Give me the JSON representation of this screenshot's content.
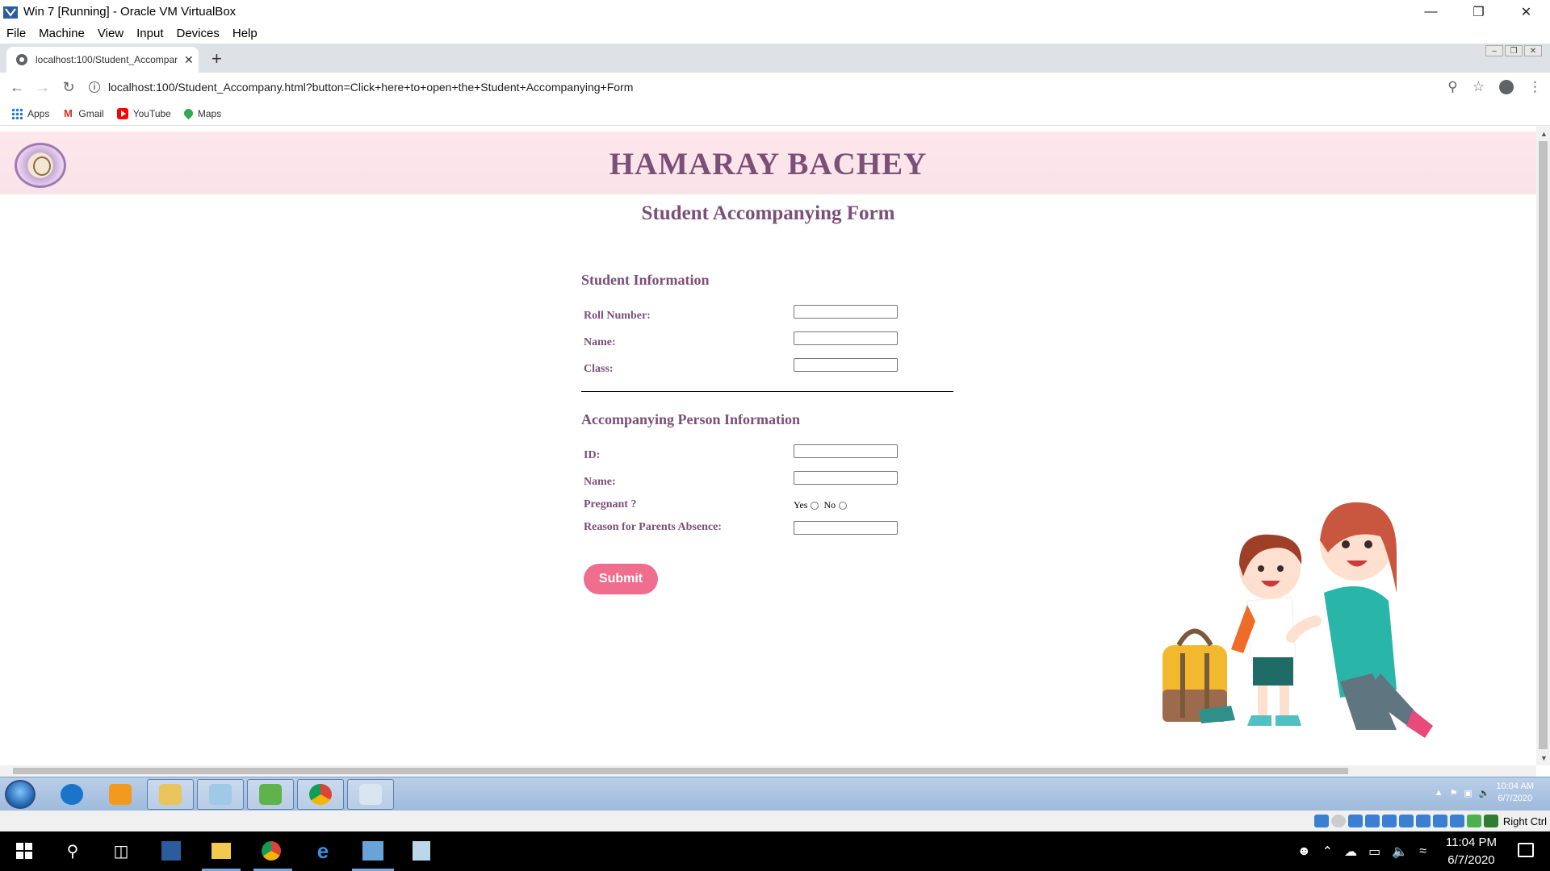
{
  "vbox": {
    "window_title": "Win 7 [Running] - Oracle VM VirtualBox",
    "menu": [
      "File",
      "Machine",
      "View",
      "Input",
      "Devices",
      "Help"
    ],
    "host_key": "Right Ctrl"
  },
  "browser": {
    "tab_title": "localhost:100/Student_Accompar",
    "url": "localhost:100/Student_Accompany.html?button=Click+here+to+open+the+Student+Accompanying+Form",
    "bookmarks": [
      "Apps",
      "Gmail",
      "YouTube",
      "Maps"
    ]
  },
  "page": {
    "site_title": "HAMARAY BACHEY",
    "form_title": "Student Accompanying Form",
    "student_section": {
      "heading": "Student Information",
      "fields": [
        "Roll Number:",
        "Name:",
        "Class:"
      ]
    },
    "person_section": {
      "heading": "Accompanying Person Information",
      "id_label": "ID:",
      "name_label": "Name:",
      "pregnant_label": "Pregnant ?",
      "yes_label": "Yes",
      "no_label": "No",
      "reason_label": "Reason for Parents Absence:"
    },
    "submit_label": "Submit"
  },
  "vm_clock": {
    "time": "10:04 AM",
    "date": "6/7/2020"
  },
  "host_clock": {
    "time": "11:04 PM",
    "date": "6/7/2020"
  },
  "colors": {
    "brand": "#7a4f78",
    "header_bg": "#fde7ec",
    "submit": "#ef6d8d"
  }
}
